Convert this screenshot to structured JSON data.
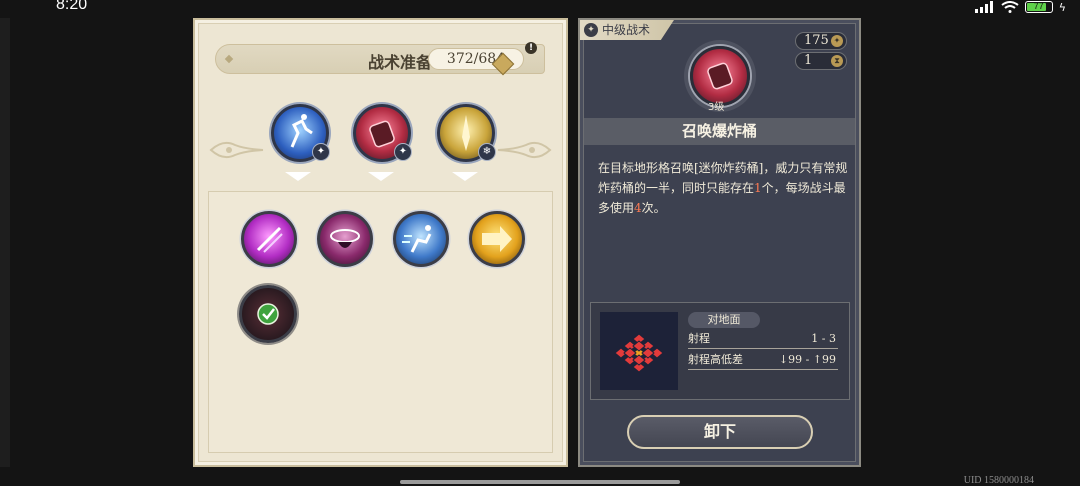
{
  "status_bar": {
    "time": "8:20",
    "battery": "77"
  },
  "left_panel": {
    "title": "战术准备",
    "points": "372/684",
    "info": "!"
  },
  "slots": [
    {
      "name": "slot-skill-dash",
      "badge": "✦",
      "color": "#3b6fd4"
    },
    {
      "name": "slot-skill-barrel",
      "badge": "✦",
      "color": "#c0354a"
    },
    {
      "name": "slot-skill-sword",
      "badge": "❄",
      "color": "#c9a43a"
    }
  ],
  "tactics": [
    {
      "name": "tactic-slash",
      "color": "#b22dc4"
    },
    {
      "name": "tactic-vortex",
      "color": "#8a2a6c"
    },
    {
      "name": "tactic-sprint",
      "color": "#3f79c9"
    },
    {
      "name": "tactic-arrow",
      "color": "#e3a21d"
    },
    {
      "name": "tactic-barrel-selected",
      "color": "#7a2f3a",
      "selected": "✓"
    }
  ],
  "right_panel": {
    "tier": "中级战术",
    "cost": "175",
    "uses": "1",
    "level": "3级",
    "skill_name": "召唤爆炸桶",
    "desc_a": "在目标地形格召唤[迷你炸药桶]，威力只有常规炸药桶的一半，同时只能存在",
    "desc_n1": "1",
    "desc_b": "个，每场战斗最多使用",
    "desc_n2": "4",
    "desc_c": "次。",
    "target": "对地面",
    "range_label": "射程",
    "range_value": "1 - 3",
    "height_label": "射程高低差",
    "height_value": "↓99 - ↑99",
    "unequip": "卸下"
  },
  "uid": "UID 1580000184",
  "colors": {
    "highlight": "#ff7a52",
    "panel_light": "#ede6d3",
    "panel_dark": "#3d4150"
  }
}
